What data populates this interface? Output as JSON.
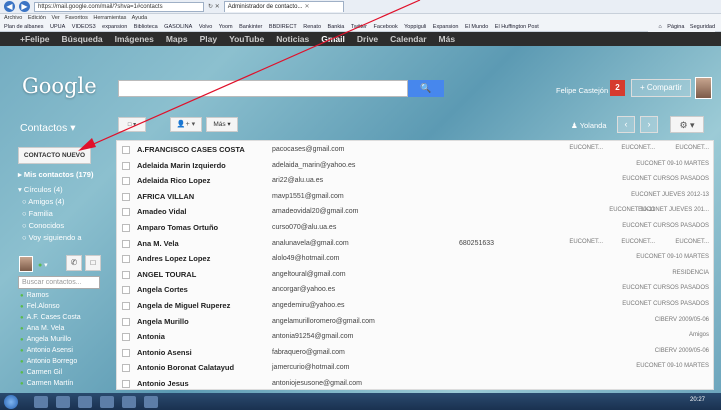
{
  "browser": {
    "url": "https://mail.google.com/mail/?shva=1#contacts",
    "tab_title": "Administrador de contacto...",
    "menu": [
      "Archivo",
      "Edición",
      "Ver",
      "Favoritos",
      "Herramientas",
      "Ayuda"
    ],
    "favorites": [
      "Plan de albanes",
      "UPUA",
      "VIDEOS3",
      "expansion",
      "Biblioteca",
      "GASOLINA",
      "Volvo",
      "Yoom",
      "Bankinter",
      "BBDIRECT",
      "Renato",
      "Bankia",
      "Twitter",
      "Facebook",
      "Yoppiguli",
      "Expansion",
      "El Mundo",
      "El Huffington Post"
    ],
    "commands": [
      "Página",
      "Seguridad"
    ]
  },
  "google_bar": [
    "+Felipe",
    "Búsqueda",
    "Imágenes",
    "Maps",
    "Play",
    "YouTube",
    "Noticias",
    "Gmail",
    "Drive",
    "Calendar",
    "Más"
  ],
  "header": {
    "logo": "Google",
    "user": "Felipe Castejón",
    "notifications": "2",
    "share": "+ Compartir"
  },
  "toolbar": {
    "section": "Contactos",
    "more": "Más",
    "group": "Yolanda"
  },
  "sidebar": {
    "new_contact": "CONTACTO NUEVO",
    "my_contacts": "Mis contactos (179)",
    "circles": "Círculos (4)",
    "circle_items": [
      "Amigos (4)",
      "Familia",
      "Conocidos",
      "Voy siguiendo a"
    ],
    "chat_search_placeholder": "Buscar contactos...",
    "chat_contacts": [
      "Ramos",
      "Fel.Alonso",
      "A.F. Cases Costa",
      "Ana M. Vela",
      "Angela Murillo",
      "Antonio Asensi",
      "Antonio Borrego",
      "Carmen Gil",
      "Carmen Martín"
    ]
  },
  "contacts": [
    {
      "name": "A.FRANCISCO CASES COSTA",
      "email": "pacocases@gmail.com",
      "phone": "",
      "labels": [
        "EUCONET...",
        "EUCONET...",
        "EUCONET..."
      ]
    },
    {
      "name": "Adelaida Marin Izquierdo",
      "email": "adelaida_marin@yahoo.es",
      "phone": "",
      "labels": [
        "EUCONET 09-10 MARTES"
      ]
    },
    {
      "name": "Adelaida Rico Lopez",
      "email": "ari22@alu.ua.es",
      "phone": "",
      "labels": [
        "EUCONET CURSOS PASADOS"
      ]
    },
    {
      "name": "AFRICA VILLAN",
      "email": "mavp1551@gmail.com",
      "phone": "",
      "labels": [
        "EUCONET JUEVES 2012-13"
      ]
    },
    {
      "name": "Amadeo Vidal",
      "email": "amadeovidal20@gmail.com",
      "phone": "",
      "labels": [
        "EUCONET 10-11",
        "EUCONET JUEVES 201..."
      ]
    },
    {
      "name": "Amparo Tomas Ortuño",
      "email": "curso070@alu.ua.es",
      "phone": "",
      "labels": [
        "EUCONET CURSOS PASADOS"
      ]
    },
    {
      "name": "Ana M. Vela",
      "email": "analunavela@gmail.com",
      "phone": "680251633",
      "labels": [
        "EUCONET...",
        "EUCONET...",
        "EUCONET..."
      ]
    },
    {
      "name": "Andres Lopez Lopez",
      "email": "alolo49@hotmail.com",
      "phone": "",
      "labels": [
        "EUCONET 09-10 MARTES"
      ]
    },
    {
      "name": "ANGEL TOURAL",
      "email": "angeltoural@gmail.com",
      "phone": "",
      "labels": [
        "RESIDENCIA"
      ]
    },
    {
      "name": "Angela Cortes",
      "email": "ancorgar@yahoo.es",
      "phone": "",
      "labels": [
        "EUCONET CURSOS PASADOS"
      ]
    },
    {
      "name": "Angela de Miguel Ruperez",
      "email": "angedemiru@yahoo.es",
      "phone": "",
      "labels": [
        "EUCONET CURSOS PASADOS"
      ]
    },
    {
      "name": "Angela Murillo",
      "email": "angelamurilloromero@gmail.com",
      "phone": "",
      "labels": [
        "CIBERV 2009/05-06"
      ]
    },
    {
      "name": "Antonia",
      "email": "antonia91254@gmail.com",
      "phone": "",
      "labels": [
        "Amigos"
      ]
    },
    {
      "name": "Antonio Asensi",
      "email": "fabraquero@gmail.com",
      "phone": "",
      "labels": [
        "CIBERV 2009/05-06"
      ]
    },
    {
      "name": "Antonio Boronat Calatayud",
      "email": "jamercurio@hotmail.com",
      "phone": "",
      "labels": [
        "EUCONET 09-10 MARTES"
      ]
    },
    {
      "name": "Antonio Jesus",
      "email": "antoniojesusone@gmail.com",
      "phone": "",
      "labels": []
    }
  ],
  "taskbar": {
    "clock": "20:27"
  },
  "colors": {
    "gbar": "#2d2d2d",
    "search_button": "#4787ed",
    "notification": "#d63b2f",
    "annotation": "#e0102a"
  }
}
